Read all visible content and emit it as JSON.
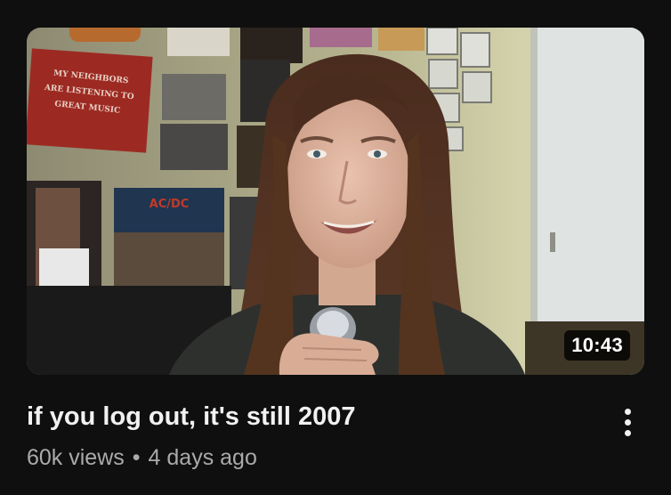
{
  "video": {
    "duration": "10:43",
    "title": "if you log out, it's still 2007",
    "views": "60k views",
    "separator": "•",
    "age": "4 days ago",
    "menu_icon": "vertical-ellipsis-icon",
    "poster_text": [
      "MY NEIGHBORS",
      "ARE LISTENING TO",
      "GREAT MUSIC"
    ],
    "album_text": "AC/DC"
  },
  "colors": {
    "background": "#0f0f0f",
    "title": "#f1f1f1",
    "meta": "#aaaaaa",
    "wall": "#c9c7a0",
    "poster_red": "#9c2a22"
  }
}
